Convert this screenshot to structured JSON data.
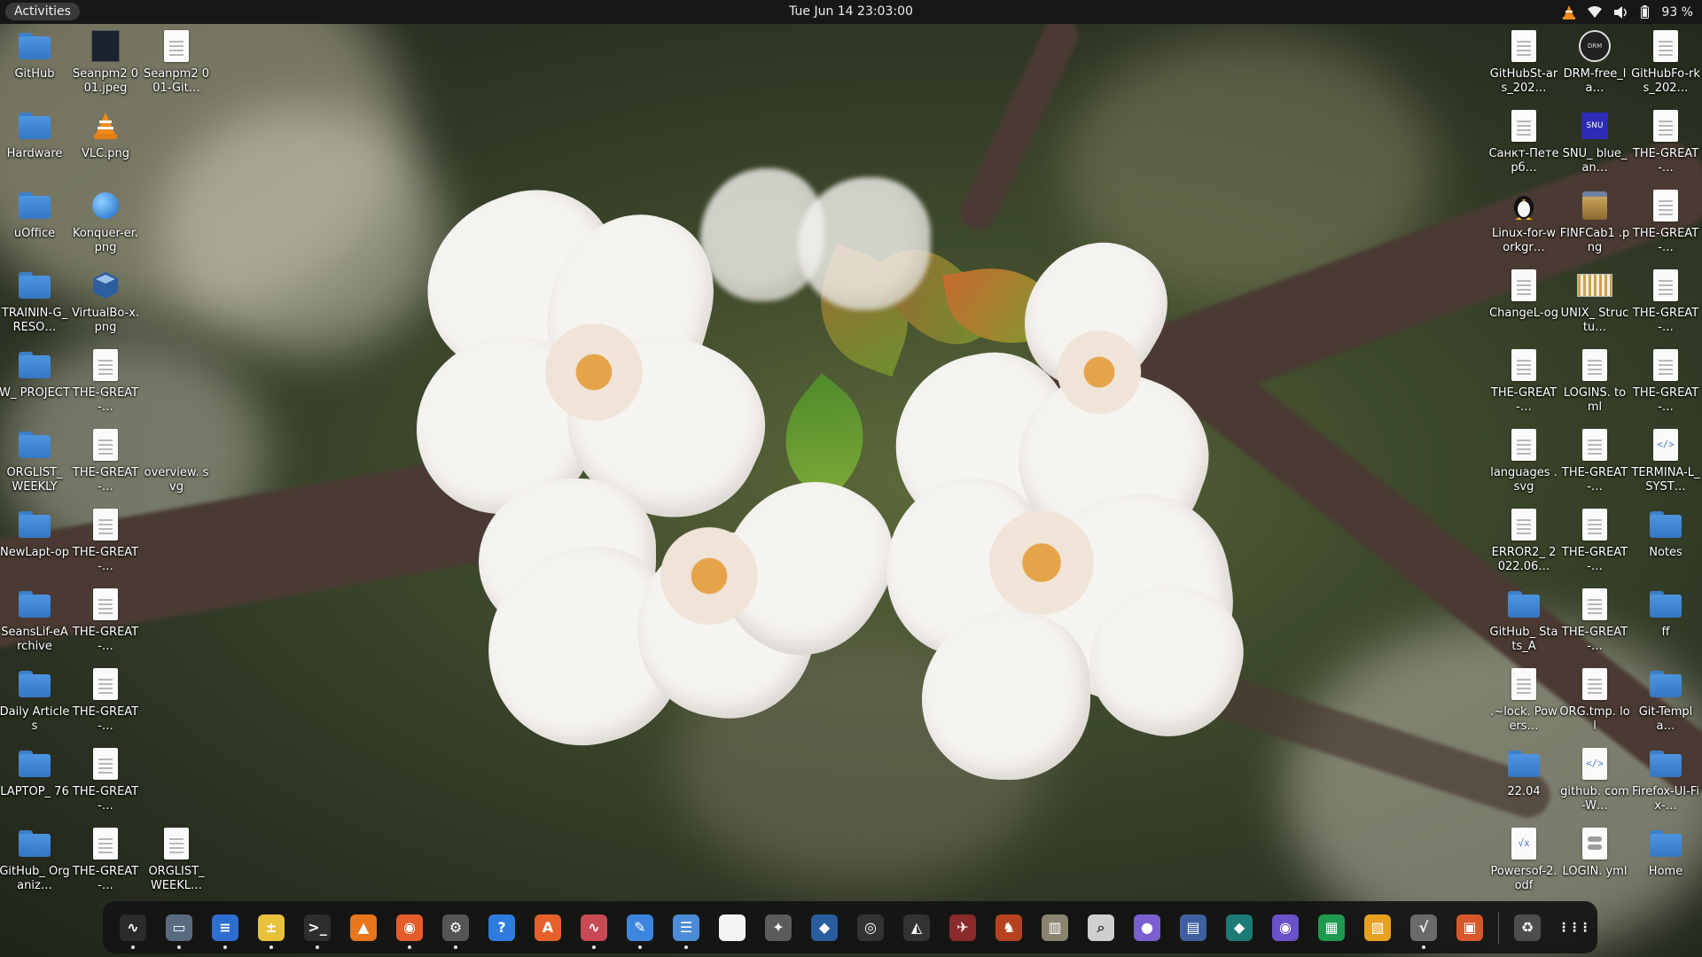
{
  "topbar": {
    "activities": "Activities",
    "clock": "Tue Jun 14  23:03:00",
    "battery": "93 %",
    "tray_icons": [
      "vlc-cone-icon",
      "wifi-icon",
      "volume-icon",
      "battery-icon"
    ]
  },
  "desktop_left": [
    {
      "label": "GitHub",
      "kind": "folder"
    },
    {
      "label": "Seanpm2 001.jpeg",
      "kind": "image-dark"
    },
    {
      "label": "Seanpm2 001-Git…",
      "kind": "doc"
    },
    {
      "label": "Hardware",
      "kind": "folder"
    },
    {
      "label": "VLC.png",
      "kind": "vlc"
    },
    {
      "label": "uOffice",
      "kind": "folder"
    },
    {
      "label": "Konquer-er.png",
      "kind": "globe"
    },
    {
      "label": "TRAININ-G_RESO…",
      "kind": "folder"
    },
    {
      "label": "VirtualBo-x.png",
      "kind": "vbox"
    },
    {
      "label": "W_ PROJECT",
      "kind": "folder"
    },
    {
      "label": "THE-GREAT-…",
      "kind": "doc"
    },
    {
      "label": "ORGLIST_ WEEKLY",
      "kind": "folder"
    },
    {
      "label": "THE-GREAT-…",
      "kind": "doc"
    },
    {
      "label": "overview. svg",
      "kind": "none"
    },
    {
      "label": "NewLapt-op",
      "kind": "folder"
    },
    {
      "label": "THE-GREAT-…",
      "kind": "doc"
    },
    {
      "label": "SeansLif-eArchive",
      "kind": "folder"
    },
    {
      "label": "THE-GREAT-…",
      "kind": "doc"
    },
    {
      "label": "Daily Articles",
      "kind": "folder"
    },
    {
      "label": "THE-GREAT-…",
      "kind": "doc"
    },
    {
      "label": "LAPTOP_ 76",
      "kind": "folder"
    },
    {
      "label": "THE-GREAT-…",
      "kind": "doc"
    },
    {
      "label": "GitHub_ Organiz…",
      "kind": "folder"
    },
    {
      "label": "THE-GREAT-…",
      "kind": "doc"
    },
    {
      "label": "ORGLIST_ WEEKL…",
      "kind": "doc"
    }
  ],
  "desktop_right": [
    {
      "label": "GitHubSt-ars_202…",
      "kind": "doc"
    },
    {
      "label": "DRM-free_la…",
      "kind": "drm"
    },
    {
      "label": "GitHubFo-rks_202…",
      "kind": "doc"
    },
    {
      "label": "Санкт-Петерб…",
      "kind": "doc"
    },
    {
      "label": "SNU_ blue_an…",
      "kind": "snu"
    },
    {
      "label": "THE-GREAT-…",
      "kind": "doc"
    },
    {
      "label": "Linux-for-workgr…",
      "kind": "tux"
    },
    {
      "label": "FINFCab1 .png",
      "kind": "cab"
    },
    {
      "label": "THE-GREAT-…",
      "kind": "doc"
    },
    {
      "label": "ChangeL-og",
      "kind": "doc"
    },
    {
      "label": "UNIX_ Structu…",
      "kind": "unix"
    },
    {
      "label": "THE-GREAT-…",
      "kind": "doc"
    },
    {
      "label": "THE-GREAT-…",
      "kind": "doc"
    },
    {
      "label": "LOGINS. toml",
      "kind": "doc"
    },
    {
      "label": "THE-GREAT-…",
      "kind": "doc"
    },
    {
      "label": "languages .svg",
      "kind": "doc"
    },
    {
      "label": "THE-GREAT-…",
      "kind": "doc"
    },
    {
      "label": "TERMINA-L_SYST…",
      "kind": "code"
    },
    {
      "label": "ERROR2_ 2022.06…",
      "kind": "doc"
    },
    {
      "label": "THE-GREAT-…",
      "kind": "doc"
    },
    {
      "label": "Notes",
      "kind": "folder"
    },
    {
      "label": "GitHub_ Stats_A",
      "kind": "folder"
    },
    {
      "label": "THE-GREAT-…",
      "kind": "doc"
    },
    {
      "label": "ff",
      "kind": "folder"
    },
    {
      "label": ".~lock. Powers…",
      "kind": "doc"
    },
    {
      "label": "ORG.tmp. lol",
      "kind": "doc"
    },
    {
      "label": "Git-Templa…",
      "kind": "folder"
    },
    {
      "label": "22.04",
      "kind": "folder"
    },
    {
      "label": "github. com-W…",
      "kind": "code"
    },
    {
      "label": "Firefox-UI-Fix-…",
      "kind": "folder"
    },
    {
      "label": "Powersof-2.odf",
      "kind": "formula"
    },
    {
      "label": "LOGIN. yml",
      "kind": "db"
    },
    {
      "label": "Home",
      "kind": "home"
    }
  ],
  "dock": [
    {
      "name": "system-monitor-icon",
      "color": "#2b2b2b",
      "glyph": "∿",
      "running": true
    },
    {
      "name": "files-icon",
      "color": "#5a6b80",
      "glyph": "▭",
      "running": true
    },
    {
      "name": "text-editor-icon",
      "color": "#2d6fd1",
      "glyph": "≡",
      "running": true
    },
    {
      "name": "calculator-icon",
      "color": "#e8c039",
      "glyph": "±",
      "running": true
    },
    {
      "name": "terminal-icon",
      "color": "#2e2e2e",
      "glyph": ">_",
      "running": true
    },
    {
      "name": "vlc-icon",
      "color": "#e8761a",
      "glyph": "▲",
      "running": false
    },
    {
      "name": "firefox-icon",
      "color": "#e55b2a",
      "glyph": "◉",
      "running": true
    },
    {
      "name": "settings-icon",
      "color": "#555",
      "glyph": "⚙",
      "running": true
    },
    {
      "name": "help-icon",
      "color": "#2f7be0",
      "glyph": "?",
      "running": false
    },
    {
      "name": "app-store-icon",
      "color": "#e6602c",
      "glyph": "A",
      "running": false
    },
    {
      "name": "activity-monitor-icon",
      "color": "#c84a54",
      "glyph": "∿",
      "running": true
    },
    {
      "name": "notes-icon",
      "color": "#3c86e0",
      "glyph": "✎",
      "running": true
    },
    {
      "name": "tweaks-icon",
      "color": "#4b8bd8",
      "glyph": "☰",
      "running": true
    },
    {
      "name": "blank-document-icon",
      "color": "#f4f4f4",
      "glyph": "",
      "running": false
    },
    {
      "name": "gimp-icon",
      "color": "#5b5b5b",
      "glyph": "✦",
      "running": false
    },
    {
      "name": "virtualbox-icon",
      "color": "#2a5d9f",
      "glyph": "◆",
      "running": false
    },
    {
      "name": "camera-icon",
      "color": "#333",
      "glyph": "◎",
      "running": false
    },
    {
      "name": "inkscape-icon",
      "color": "#333",
      "glyph": "◭",
      "running": false
    },
    {
      "name": "game-car-icon",
      "color": "#8b2a2a",
      "glyph": "✈",
      "running": false
    },
    {
      "name": "game-character-icon",
      "color": "#b5421f",
      "glyph": "♞",
      "running": false
    },
    {
      "name": "archive-icon",
      "color": "#8a8470",
      "glyph": "▥",
      "running": false
    },
    {
      "name": "search-icon",
      "color": "#cfcfcf",
      "glyph": "⌕",
      "running": false
    },
    {
      "name": "color-picker-icon",
      "color": "#7a5fd0",
      "glyph": "●",
      "running": false
    },
    {
      "name": "book-icon",
      "color": "#3f5fa0",
      "glyph": "▤",
      "running": false
    },
    {
      "name": "education-icon",
      "color": "#1d7a76",
      "glyph": "◆",
      "running": false
    },
    {
      "name": "obs-icon",
      "color": "#6b52c8",
      "glyph": "◉",
      "running": false
    },
    {
      "name": "spreadsheet-icon",
      "color": "#1e9a4f",
      "glyph": "▦",
      "running": false
    },
    {
      "name": "presentation-icon",
      "color": "#e8a020",
      "glyph": "▧",
      "running": false
    },
    {
      "name": "math-formula-icon",
      "color": "#6a6a6a",
      "glyph": "√",
      "running": true
    },
    {
      "name": "impress-icon",
      "color": "#d7582a",
      "glyph": "▣",
      "running": false
    },
    {
      "name": "trash-icon",
      "color": "#4d4d4d",
      "glyph": "♻",
      "running": false
    },
    {
      "name": "app-grid-icon",
      "color": "transparent",
      "glyph": "⋮⋮⋮",
      "running": false
    }
  ]
}
